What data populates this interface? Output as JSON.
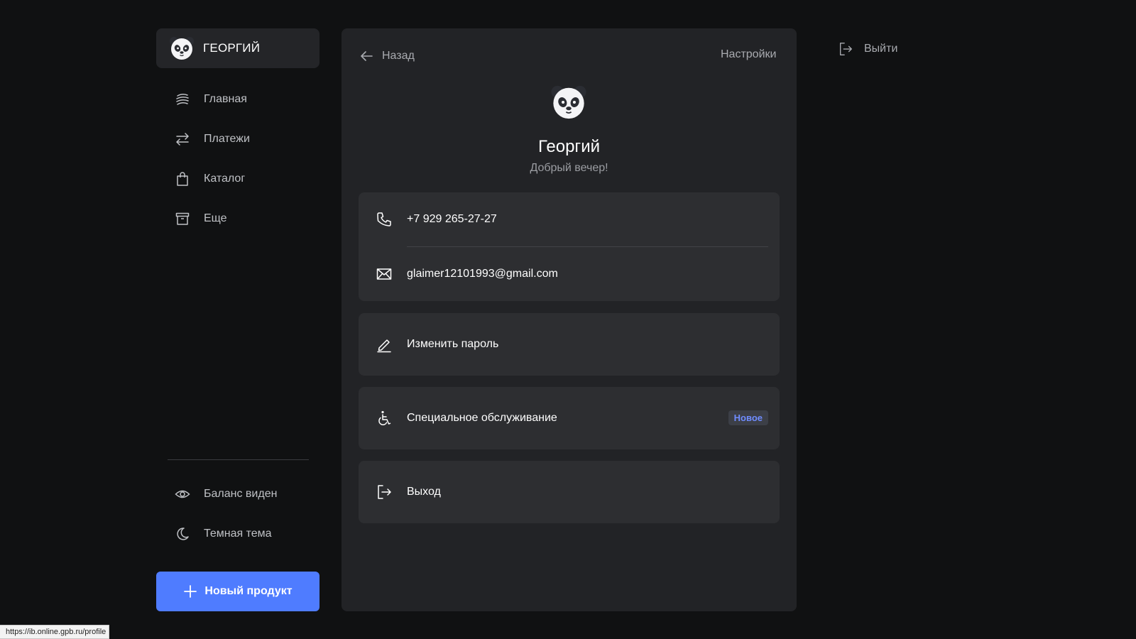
{
  "user_chip": {
    "name": "ГЕОРГИЙ",
    "avatar_icon": "panda-icon"
  },
  "sidebar": {
    "items": [
      {
        "label": "Главная",
        "icon": "home-waves-icon"
      },
      {
        "label": "Платежи",
        "icon": "transfer-arrows-icon"
      },
      {
        "label": "Каталог",
        "icon": "shopping-bag-icon"
      },
      {
        "label": "Еще",
        "icon": "archive-box-icon"
      }
    ],
    "toggles": [
      {
        "label": "Баланс виден",
        "icon": "eye-icon"
      },
      {
        "label": "Темная тема",
        "icon": "moon-icon"
      }
    ],
    "new_product_label": "Новый продукт"
  },
  "header": {
    "back_label": "Назад",
    "settings_label": "Настройки",
    "logout_label": "Выйти"
  },
  "profile": {
    "name": "Георгий",
    "greeting": "Добрый вечер!",
    "phone": "+7 929 265-27-27",
    "email": "glaimer12101993@gmail.com"
  },
  "actions": {
    "change_password": "Изменить пароль",
    "special_service": "Специальное обслуживание",
    "special_badge": "Новое",
    "exit": "Выход"
  },
  "status_bar": {
    "url": "https://ib.online.gpb.ru/profile"
  },
  "colors": {
    "background": "#101112",
    "panel": "#222326",
    "card": "#2d2e31",
    "accent": "#4f7cff",
    "badge_text": "#6f8cff"
  }
}
